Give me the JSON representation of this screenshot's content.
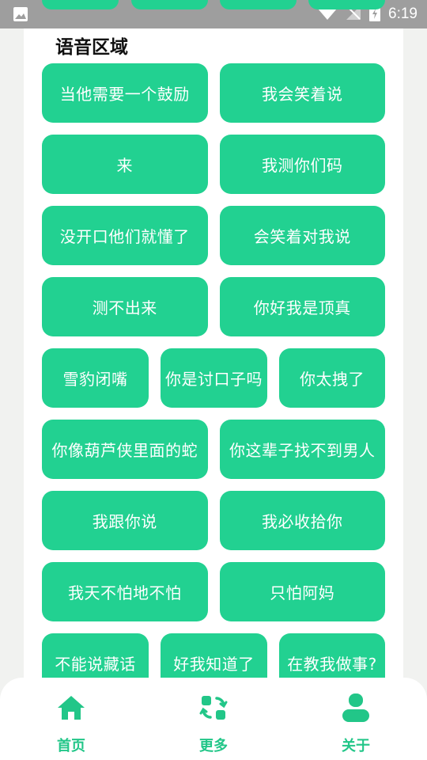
{
  "status_bar": {
    "time": "6:19",
    "icons": [
      "image-icon",
      "wifi-icon",
      "no-signal-icon",
      "battery-charging-icon"
    ]
  },
  "section": {
    "title": "语音区域"
  },
  "sound_buttons": [
    "当他需要一个鼓励",
    "我会笑着说",
    "来",
    "我测你们码",
    "没开口他们就懂了",
    "会笑着对我说",
    "测不出来",
    "你好我是顶真",
    "雪豹闭嘴",
    "你是讨口子吗",
    "你太拽了",
    "你像葫芦侠里面的蛇",
    "你这辈子找不到男人",
    "我跟你说",
    "我必收拾你",
    "我天不怕地不怕",
    "只怕阿妈",
    "不能说藏话",
    "好我知道了",
    "在教我做事?"
  ],
  "bottom_nav": {
    "items": [
      {
        "label": "首页",
        "icon": "home-icon"
      },
      {
        "label": "更多",
        "icon": "refresh-icon"
      },
      {
        "label": "关于",
        "icon": "user-icon"
      }
    ]
  },
  "colors": {
    "accent": "#22d191",
    "nav_accent": "#22c688",
    "status_bar": "#9e9e9e",
    "background": "#f1f2f0"
  }
}
